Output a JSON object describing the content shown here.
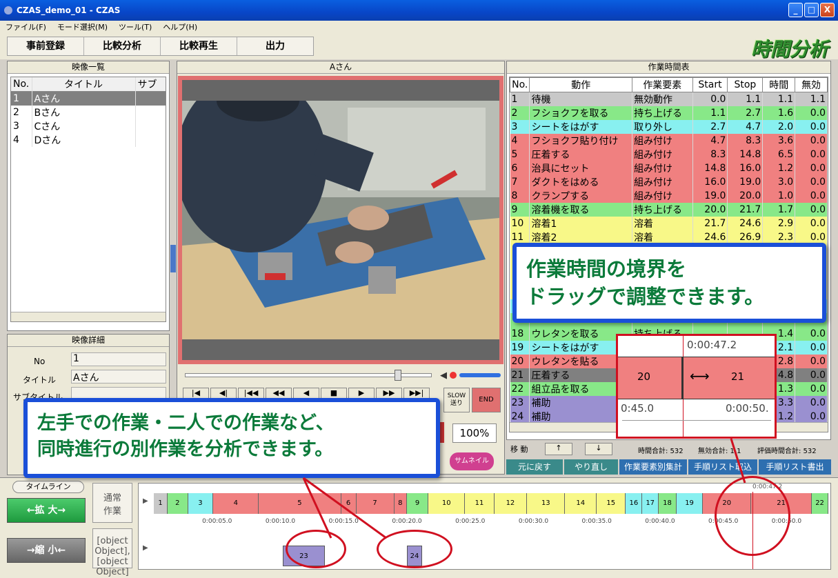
{
  "window": {
    "title": "CZAS_demo_01 - CZAS",
    "min": "_",
    "max": "□",
    "close": "X"
  },
  "menu": [
    "ファイル(F)",
    "モード選択(M)",
    "ツール(T)",
    "ヘルプ(H)"
  ],
  "nav": [
    "事前登録",
    "比較分析",
    "比較再生",
    "出力"
  ],
  "logo": "時間分析",
  "video_list": {
    "title": "映像一覧",
    "columns": [
      "No.",
      "タイトル",
      "サブ"
    ],
    "rows": [
      [
        "1",
        "Aさん"
      ],
      [
        "2",
        "Bさん"
      ],
      [
        "3",
        "Cさん"
      ],
      [
        "4",
        "Dさん"
      ]
    ]
  },
  "video_detail": {
    "title": "映像詳細",
    "no_label": "No",
    "no_value": "1",
    "title_label": "タイトル",
    "title_value": "Aさん",
    "subtitle_label": "サブタイトル"
  },
  "player": {
    "title": "Aさん",
    "slow_label": "SLOW\n送り",
    "end_label": "END",
    "zoom": "100%",
    "thumbnail_label": "サムネイル"
  },
  "work_table": {
    "title": "作業時間表",
    "columns": [
      "No.",
      "動作",
      "作業要素",
      "Start",
      "Stop",
      "時間",
      "無効"
    ],
    "rows": [
      {
        "no": "1",
        "act": "待機",
        "elem": "無効動作",
        "start": "0.0",
        "stop": "1.1",
        "time": "1.1",
        "inv": "1.1",
        "color": "#c8c8c8"
      },
      {
        "no": "2",
        "act": "フショクフを取る",
        "elem": "持ち上げる",
        "start": "1.1",
        "stop": "2.7",
        "time": "1.6",
        "inv": "0.0",
        "color": "#88e888"
      },
      {
        "no": "3",
        "act": "シートをはがす",
        "elem": "取り外し",
        "start": "2.7",
        "stop": "4.7",
        "time": "2.0",
        "inv": "0.0",
        "color": "#88f0f0"
      },
      {
        "no": "4",
        "act": "フショクフ貼り付け",
        "elem": "組み付け",
        "start": "4.7",
        "stop": "8.3",
        "time": "3.6",
        "inv": "0.0",
        "color": "#f08080"
      },
      {
        "no": "5",
        "act": "圧着する",
        "elem": "組み付け",
        "start": "8.3",
        "stop": "14.8",
        "time": "6.5",
        "inv": "0.0",
        "color": "#f08080"
      },
      {
        "no": "6",
        "act": "治具にセット",
        "elem": "組み付け",
        "start": "14.8",
        "stop": "16.0",
        "time": "1.2",
        "inv": "0.0",
        "color": "#f08080"
      },
      {
        "no": "7",
        "act": "ダクトをはめる",
        "elem": "組み付け",
        "start": "16.0",
        "stop": "19.0",
        "time": "3.0",
        "inv": "0.0",
        "color": "#f08080"
      },
      {
        "no": "8",
        "act": "クランプする",
        "elem": "組み付け",
        "start": "19.0",
        "stop": "20.0",
        "time": "1.0",
        "inv": "0.0",
        "color": "#f08080"
      },
      {
        "no": "9",
        "act": "溶着機を取る",
        "elem": "持ち上げる",
        "start": "20.0",
        "stop": "21.7",
        "time": "1.7",
        "inv": "0.0",
        "color": "#88e888"
      },
      {
        "no": "10",
        "act": "溶着1",
        "elem": "溶着",
        "start": "21.7",
        "stop": "24.6",
        "time": "2.9",
        "inv": "0.0",
        "color": "#f8f888"
      },
      {
        "no": "11",
        "act": "溶着2",
        "elem": "溶着",
        "start": "24.6",
        "stop": "26.9",
        "time": "2.3",
        "inv": "0.0",
        "color": "#f8f888"
      },
      {
        "no": "",
        "act": "",
        "elem": "",
        "start": "",
        "stop": "",
        "time": "",
        "inv": "0.0",
        "color": "#f8f888"
      },
      {
        "no": "",
        "act": "",
        "elem": "",
        "start": "",
        "stop": "",
        "time": "",
        "inv": "0.0",
        "color": "#f8f888"
      },
      {
        "no": "",
        "act": "",
        "elem": "",
        "start": "",
        "stop": "",
        "time": "",
        "inv": "0.0",
        "color": "#f8f888"
      },
      {
        "no": "",
        "act": "",
        "elem": "",
        "start": "",
        "stop": "",
        "time": "",
        "inv": "0.0",
        "color": "#f8f888"
      },
      {
        "no": "",
        "act": "",
        "elem": "",
        "start": "",
        "stop": "",
        "time": "",
        "inv": "0.0",
        "color": "#88f0f0"
      },
      {
        "no": "",
        "act": "",
        "elem": "",
        "start": "",
        "stop": "",
        "time": "",
        "inv": "0.0",
        "color": "#88e888"
      },
      {
        "no": "18",
        "act": "ウレタンを取る",
        "elem": "持ち上げる",
        "start": "",
        "stop": "",
        "time": "1.4",
        "inv": "0.0",
        "color": "#88e888"
      },
      {
        "no": "19",
        "act": "シートをはがす",
        "elem": "",
        "start": "",
        "stop": "",
        "time": "2.1",
        "inv": "0.0",
        "color": "#88f0f0"
      },
      {
        "no": "20",
        "act": "ウレタンを貼る",
        "elem": "",
        "start": "",
        "stop": "",
        "time": "2.8",
        "inv": "0.0",
        "color": "#f08080"
      },
      {
        "no": "21",
        "act": "圧着する",
        "elem": "",
        "start": "",
        "stop": "",
        "time": "4.8",
        "inv": "0.0",
        "color": "#808080"
      },
      {
        "no": "22",
        "act": "組立品を取る",
        "elem": "",
        "start": "",
        "stop": "",
        "time": "1.3",
        "inv": "0.0",
        "color": "#88e888"
      },
      {
        "no": "23",
        "act": "補助",
        "elem": "",
        "start": "",
        "stop": "",
        "time": "3.3",
        "inv": "0.0",
        "color": "#9a90d0"
      },
      {
        "no": "24",
        "act": "補助",
        "elem": "",
        "start": "",
        "stop": "",
        "time": "1.2",
        "inv": "0.0",
        "color": "#9a90d0"
      }
    ]
  },
  "move": {
    "label": "移 動",
    "up": "↑",
    "down": "↓"
  },
  "totals": {
    "total": "時間合計: 532",
    "invalid": "無効合計: 1.1",
    "eval": "評価時間合計: 532"
  },
  "actions": [
    "元に戻す",
    "やり直し",
    "作業要素別集計",
    "手順リスト取込",
    "手順リスト書出"
  ],
  "timeline": {
    "label": "タイムライン",
    "zoom_in": "←拡 大→",
    "zoom_out": "→縮 小←",
    "normal": "通常\n作業",
    "parallel": [
      {
        "label": "23",
        "start": 10.2,
        "stop": 13.5,
        "color": "#9a90d0"
      },
      {
        "label": "24",
        "start": 20.0,
        "stop": 21.2,
        "color": "#9a90d0"
      }
    ],
    "cursor_time": "0:00:47.2",
    "ticks": [
      "0:00:05.0",
      "0:00:10.0",
      "0:00:15.0",
      "0:00:20.0",
      "0:00:25.0",
      "0:00:30.0",
      "0:00:35.0",
      "0:00:40.0",
      "0:00:45.0",
      "0:00:50.0"
    ],
    "segments": [
      {
        "label": "1",
        "start": 0.0,
        "stop": 1.1,
        "color": "#c8c8c8"
      },
      {
        "label": "2",
        "start": 1.1,
        "stop": 2.7,
        "color": "#88e888"
      },
      {
        "label": "3",
        "start": 2.7,
        "stop": 4.7,
        "color": "#88f0f0"
      },
      {
        "label": "4",
        "start": 4.7,
        "stop": 8.3,
        "color": "#f08080"
      },
      {
        "label": "5",
        "start": 8.3,
        "stop": 14.8,
        "color": "#f08080"
      },
      {
        "label": "6",
        "start": 14.8,
        "stop": 16.0,
        "color": "#f08080"
      },
      {
        "label": "7",
        "start": 16.0,
        "stop": 19.0,
        "color": "#f08080"
      },
      {
        "label": "8",
        "start": 19.0,
        "stop": 20.0,
        "color": "#f08080"
      },
      {
        "label": "9",
        "start": 20.0,
        "stop": 21.7,
        "color": "#88e888"
      },
      {
        "label": "10",
        "start": 21.7,
        "stop": 24.6,
        "color": "#f8f888"
      },
      {
        "label": "11",
        "start": 24.6,
        "stop": 26.9,
        "color": "#f8f888"
      },
      {
        "label": "12",
        "start": 26.9,
        "stop": 29.5,
        "color": "#f8f888"
      },
      {
        "label": "13",
        "start": 29.5,
        "stop": 32.5,
        "color": "#f8f888"
      },
      {
        "label": "14",
        "start": 32.5,
        "stop": 35.0,
        "color": "#f8f888"
      },
      {
        "label": "15",
        "start": 35.0,
        "stop": 37.3,
        "color": "#f8f888"
      },
      {
        "label": "16",
        "start": 37.3,
        "stop": 38.6,
        "color": "#88f0f0"
      },
      {
        "label": "17",
        "start": 38.6,
        "stop": 39.9,
        "color": "#88f0f0"
      },
      {
        "label": "18",
        "start": 39.9,
        "stop": 41.3,
        "color": "#88e888"
      },
      {
        "label": "19",
        "start": 41.3,
        "stop": 43.4,
        "color": "#88f0f0"
      },
      {
        "label": "20",
        "start": 43.4,
        "stop": 47.2,
        "color": "#f08080"
      },
      {
        "label": "21",
        "start": 47.2,
        "stop": 52.0,
        "color": "#f08080"
      },
      {
        "label": "22",
        "start": 52.0,
        "stop": 53.3,
        "color": "#88e888"
      }
    ]
  },
  "zoom_inset": {
    "time_top": "0:00:47.2",
    "left_label": "20",
    "right_label": "21",
    "arrow": "⟷",
    "time_left": "0:45.0",
    "time_right": "0:00:50."
  },
  "callout_right": {
    "line1": "作業時間の境界を",
    "line2": "ドラッグで調整できます。"
  },
  "callout_left": {
    "line1": "左手での作業・二人での作業など、",
    "line2": "同時進行の別作業を分析できます。"
  }
}
